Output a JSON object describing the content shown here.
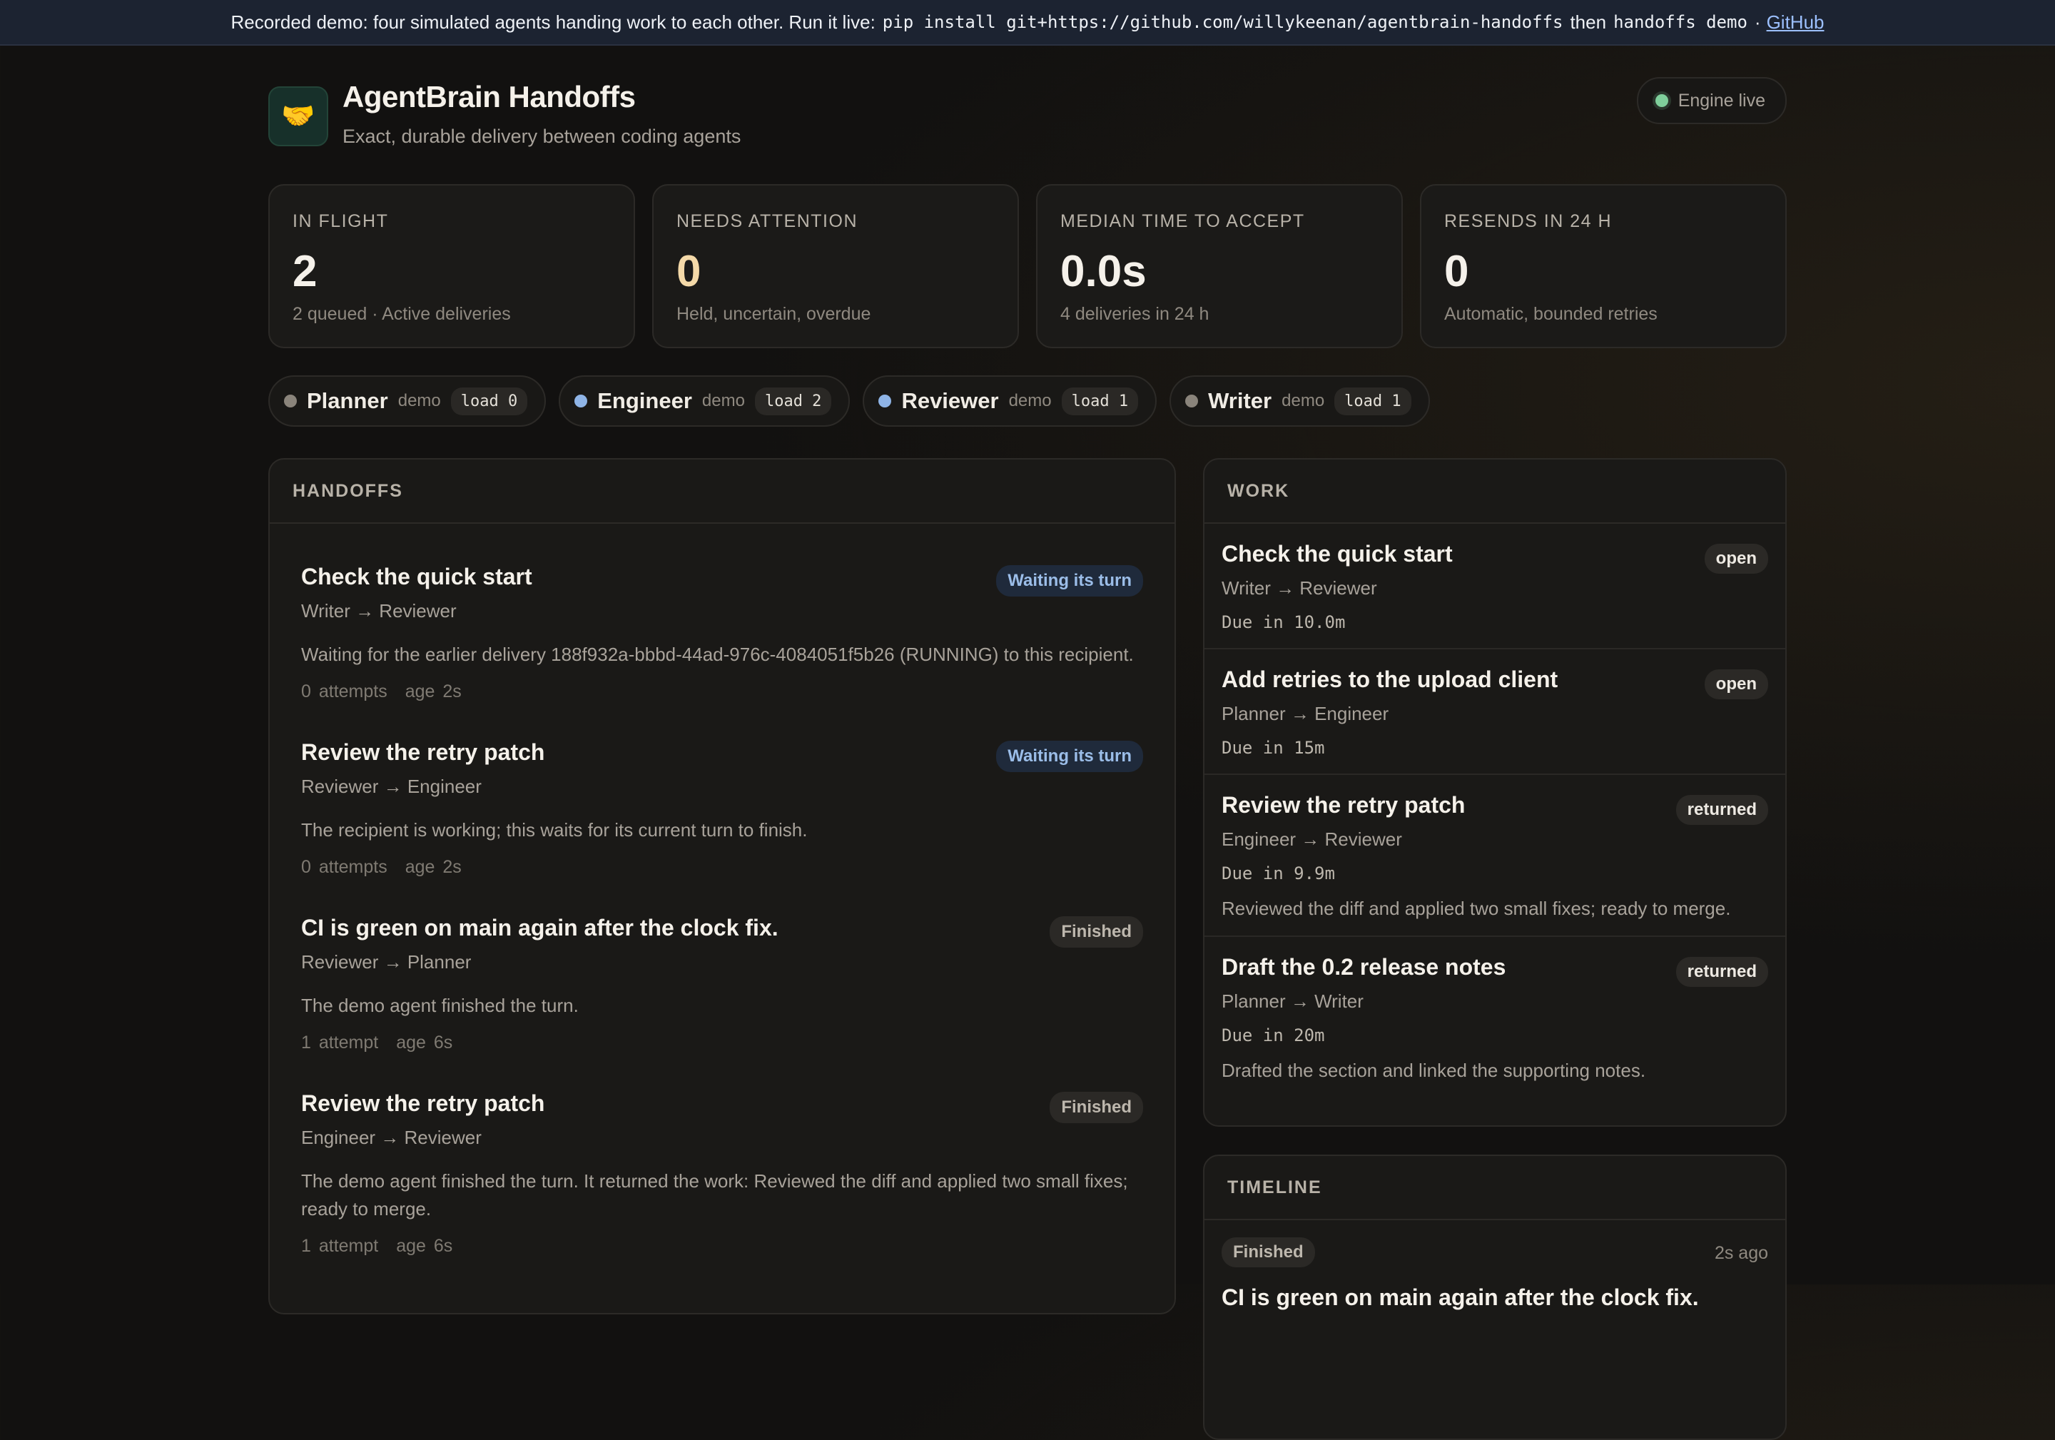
{
  "banner": {
    "text": "Recorded demo: four simulated agents handing work to each other. Run it live:",
    "command": "pip install git+https://github.com/willykeenan/agentbrain-handoffs",
    "then": "then",
    "command2": "handoffs demo",
    "sep": "·",
    "link": "GitHub"
  },
  "header": {
    "logo_icon": "🤝",
    "title": "AgentBrain Handoffs",
    "subtitle": "Exact, durable delivery between coding agents",
    "status": "Engine live",
    "status_color": "#7fcf9b"
  },
  "stats": [
    {
      "label": "In flight",
      "value": "2",
      "note": "2 queued · Active deliveries"
    },
    {
      "label": "Needs attention",
      "value": "0",
      "note": "Held, uncertain, overdue"
    },
    {
      "label": "Median time to accept",
      "value": "0.0s",
      "note": "4 deliveries in 24 h"
    },
    {
      "label": "Resends in 24 h",
      "value": "0",
      "note": "Automatic, bounded retries"
    }
  ],
  "agents": [
    {
      "name": "Planner",
      "mode": "demo",
      "load": "load 0",
      "color": "#8a847b"
    },
    {
      "name": "Engineer",
      "mode": "demo",
      "load": "load 2",
      "color": "#8fb4e6"
    },
    {
      "name": "Reviewer",
      "mode": "demo",
      "load": "load 1",
      "color": "#8fb4e6"
    },
    {
      "name": "Writer",
      "mode": "demo",
      "load": "load 1",
      "color": "#8a847b"
    }
  ],
  "handoffs": {
    "heading": "Handoffs",
    "items": [
      {
        "title": "Check the quick start",
        "route": "Writer → Reviewer",
        "status": "Waiting its turn",
        "desc": "Waiting for the earlier delivery 188f932a-bbbd-44ad-976c-4084051f5b26 (RUNNING) to this recipient.",
        "attempts": "0 attempts",
        "age": "age 2s"
      },
      {
        "title": "Review the retry patch",
        "route": "Reviewer → Engineer",
        "status": "Waiting its turn",
        "desc": "The recipient is working; this waits for its current turn to finish.",
        "attempts": "0 attempts",
        "age": "age 2s"
      },
      {
        "title": "CI is green on main again after the clock fix.",
        "route": "Reviewer → Planner",
        "status": "Finished",
        "desc": "The demo agent finished the turn.",
        "attempts": "1 attempt",
        "age": "age 6s"
      },
      {
        "title": "Review the retry patch",
        "route": "Engineer → Reviewer",
        "status": "Finished",
        "desc": "The demo agent finished the turn. It returned the work: Reviewed the diff and applied two small fixes; ready to merge.",
        "attempts": "1 attempt",
        "age": "age 6s"
      }
    ]
  },
  "work": {
    "heading": "Work",
    "items": [
      {
        "title": "Check the quick start",
        "route": "Writer → Reviewer",
        "status": "open",
        "due": "Due in 10.0m",
        "note": ""
      },
      {
        "title": "Add retries to the upload client",
        "route": "Planner → Engineer",
        "status": "open",
        "due": "Due in 15m",
        "note": ""
      },
      {
        "title": "Review the retry patch",
        "route": "Engineer → Reviewer",
        "status": "returned",
        "due": "Due in 9.9m",
        "note": "Reviewed the diff and applied two small fixes; ready to merge."
      },
      {
        "title": "Draft the 0.2 release notes",
        "route": "Planner → Writer",
        "status": "returned",
        "due": "Due in 20m",
        "note": "Drafted the section and linked the supporting notes."
      }
    ]
  },
  "timeline": {
    "heading": "Timeline",
    "items": [
      {
        "status": "Finished",
        "age": "2s ago",
        "title": "CI is green on main again after the clock fix."
      }
    ]
  }
}
